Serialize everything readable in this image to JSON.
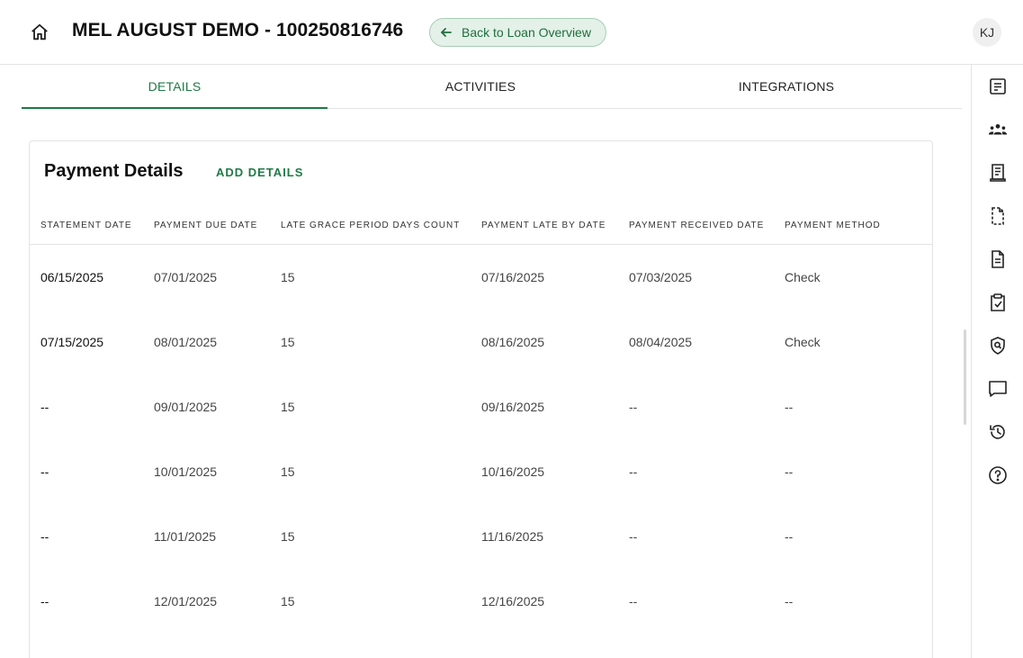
{
  "header": {
    "title": "MEL AUGUST DEMO - 100250816746",
    "back_label": "Back to Loan Overview",
    "avatar_initials": "KJ"
  },
  "tabs": [
    {
      "label": "DETAILS",
      "active": true
    },
    {
      "label": "ACTIVITIES",
      "active": false
    },
    {
      "label": "INTEGRATIONS",
      "active": false
    }
  ],
  "right_rail": {
    "icons": [
      "loan-summary-icon",
      "borrowers-icon",
      "receipt-icon",
      "document-dashed-icon",
      "document-icon",
      "clipboard-check-icon",
      "shield-search-icon",
      "chat-icon",
      "history-icon",
      "help-icon"
    ]
  },
  "payment_details": {
    "title": "Payment Details",
    "add_label": "ADD DETAILS",
    "columns": [
      "STATEMENT DATE",
      "PAYMENT DUE DATE",
      "LATE GRACE PERIOD DAYS COUNT",
      "PAYMENT LATE BY DATE",
      "PAYMENT RECEIVED DATE",
      "PAYMENT METHOD"
    ],
    "rows": [
      [
        "06/15/2025",
        "07/01/2025",
        "15",
        "07/16/2025",
        "07/03/2025",
        "Check"
      ],
      [
        "07/15/2025",
        "08/01/2025",
        "15",
        "08/16/2025",
        "08/04/2025",
        "Check"
      ],
      [
        "--",
        "09/01/2025",
        "15",
        "09/16/2025",
        "--",
        "--"
      ],
      [
        "--",
        "10/01/2025",
        "15",
        "10/16/2025",
        "--",
        "--"
      ],
      [
        "--",
        "11/01/2025",
        "15",
        "11/16/2025",
        "--",
        "--"
      ],
      [
        "--",
        "12/01/2025",
        "15",
        "12/16/2025",
        "--",
        "--"
      ]
    ]
  },
  "colors": {
    "accent": "#1f7a45",
    "back_button_bg": "#e3f1e8",
    "border": "#e3e3e3"
  }
}
